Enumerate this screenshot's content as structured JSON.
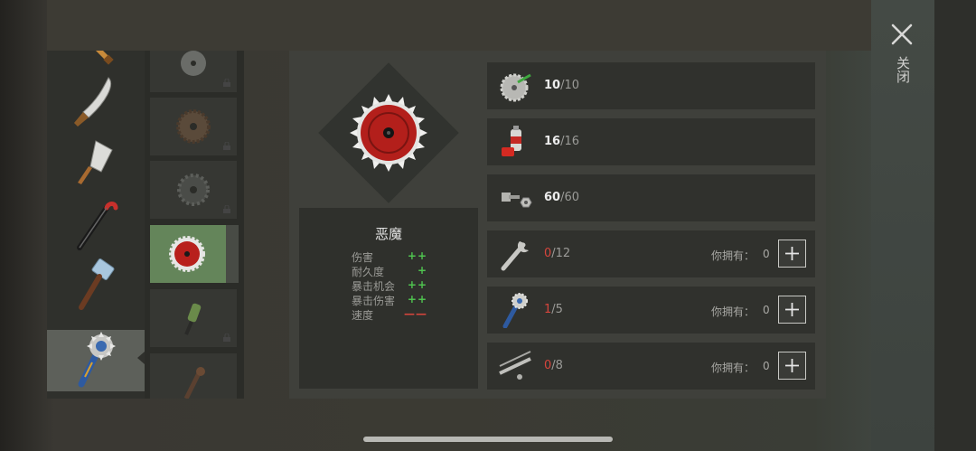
{
  "close": {
    "label": "关闭",
    "icon": "close-icon"
  },
  "weapon": {
    "name": "恶魔",
    "stats": [
      {
        "label": "伤害",
        "value": "++",
        "kind": "good"
      },
      {
        "label": "耐久度",
        "value": "+",
        "kind": "good"
      },
      {
        "label": "暴击机会",
        "value": "++",
        "kind": "good"
      },
      {
        "label": "暴击伤害",
        "value": "++",
        "kind": "good"
      },
      {
        "label": "速度",
        "value": "——",
        "kind": "bad"
      }
    ]
  },
  "weapons": [
    {
      "icon": "partial-weapon-icon"
    },
    {
      "icon": "machete-icon"
    },
    {
      "icon": "cleaver-icon"
    },
    {
      "icon": "crowbar-icon"
    },
    {
      "icon": "hammer-icon"
    },
    {
      "icon": "saw-mace-icon",
      "selected": true
    }
  ],
  "attachments": [
    {
      "icon": "saw-blade-gray-icon",
      "locked": true
    },
    {
      "icon": "saw-blade-rusty-icon",
      "locked": true
    },
    {
      "icon": "saw-blade-dark-icon",
      "locked": true
    },
    {
      "icon": "saw-blade-red-icon",
      "selected": true
    },
    {
      "icon": "green-grip-icon",
      "locked": true
    },
    {
      "icon": "rusty-attachment-icon",
      "locked": true
    }
  ],
  "resources": [
    {
      "icon": "saw-blade-part-icon",
      "have": "10",
      "need": "/10",
      "lack": false
    },
    {
      "icon": "spray-paint-icon",
      "have": "16",
      "need": "/16",
      "lack": false
    },
    {
      "icon": "bolt-nut-icon",
      "have": "60",
      "need": "/60",
      "lack": false
    },
    {
      "icon": "wrench-icon",
      "have": "0",
      "need": "/12",
      "lack": true,
      "owned_label": "你拥有：",
      "owned": "0"
    },
    {
      "icon": "saw-mace-part-icon",
      "have": "1",
      "need": "/5",
      "lack": true,
      "owned_label": "你拥有：",
      "owned": "0"
    },
    {
      "icon": "pipe-parts-icon",
      "have": "0",
      "need": "/8",
      "lack": true,
      "owned_label": "你拥有：",
      "owned": "0"
    }
  ],
  "colors": {
    "good": "#4fc24f",
    "bad": "#d6453c",
    "selected_attachment": "#64855a"
  }
}
